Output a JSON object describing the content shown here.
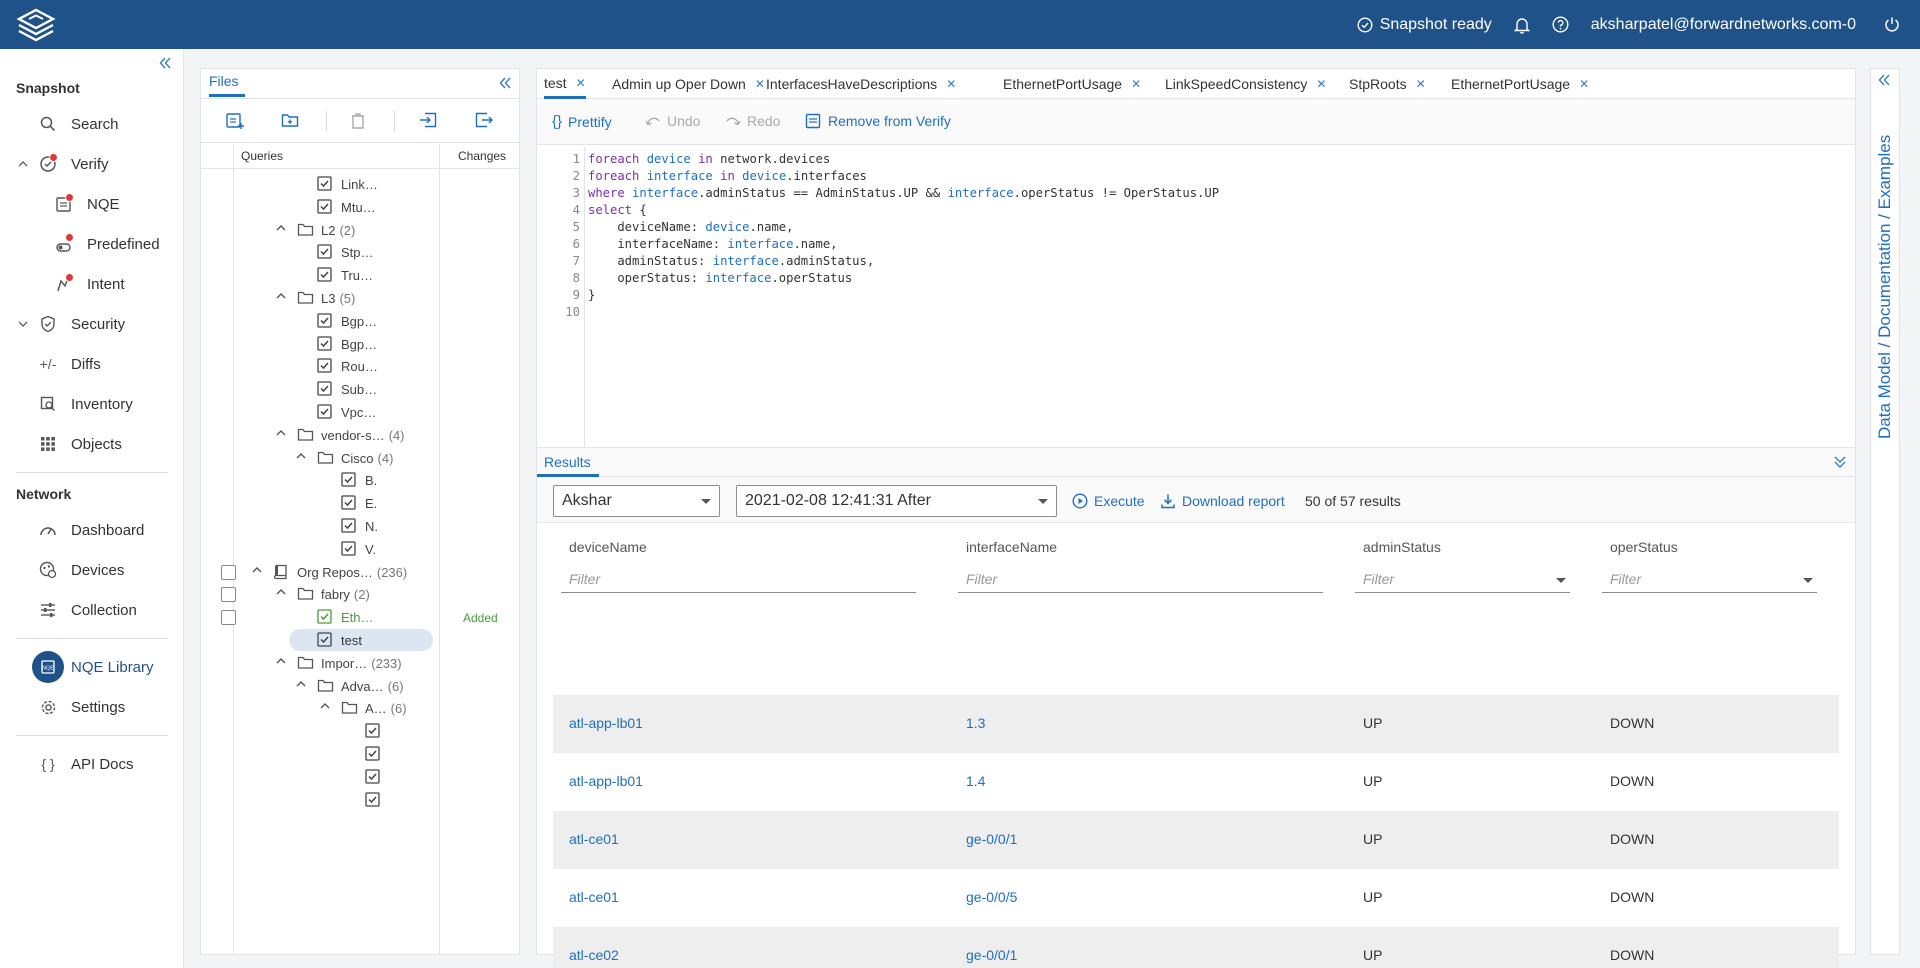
{
  "topbar": {
    "status": "Snapshot ready",
    "user": "aksharpatel@forwardnetworks.com-0"
  },
  "nav": {
    "snapshot_heading": "Snapshot",
    "search": "Search",
    "verify": "Verify",
    "nqe": "NQE",
    "predefined": "Predefined",
    "intent": "Intent",
    "security": "Security",
    "diffs": "Diffs",
    "inventory": "Inventory",
    "objects": "Objects",
    "network_heading": "Network",
    "dashboard": "Dashboard",
    "devices": "Devices",
    "collection": "Collection",
    "nqe_library": "NQE Library",
    "settings": "Settings",
    "api_docs": "API Docs"
  },
  "files": {
    "tab": "Files",
    "col_queries": "Queries",
    "col_changes": "Changes",
    "tree": [
      {
        "label": "Link…",
        "count": ""
      },
      {
        "label": "Mtu…",
        "count": ""
      },
      {
        "label": "L2",
        "count": "(2)"
      },
      {
        "label": "Stp…",
        "count": ""
      },
      {
        "label": "Tru…",
        "count": ""
      },
      {
        "label": "L3",
        "count": "(5)"
      },
      {
        "label": "Bgp…",
        "count": ""
      },
      {
        "label": "Bgp…",
        "count": ""
      },
      {
        "label": "Rou…",
        "count": ""
      },
      {
        "label": "Sub…",
        "count": ""
      },
      {
        "label": "Vpc…",
        "count": ""
      },
      {
        "label": "vendor-s…",
        "count": "(4)"
      },
      {
        "label": "Cisco",
        "count": "(4)"
      },
      {
        "label": "B.",
        "count": ""
      },
      {
        "label": "E.",
        "count": ""
      },
      {
        "label": "N.",
        "count": ""
      },
      {
        "label": "V.",
        "count": ""
      },
      {
        "label": "Org Repos…",
        "count": "(236)"
      },
      {
        "label": "fabry",
        "count": "(2)"
      },
      {
        "label": "Eth…",
        "count": ""
      },
      {
        "label": "test",
        "count": ""
      },
      {
        "label": "Impor…",
        "count": "(233)"
      },
      {
        "label": "Adva…",
        "count": "(6)"
      },
      {
        "label": "A…",
        "count": "(6)"
      }
    ],
    "added_label": "Added"
  },
  "editor": {
    "tabs": [
      "test",
      "Admin up Oper Down",
      "InterfacesHaveDescriptions",
      "EthernetPortUsage",
      "LinkSpeedConsistency",
      "StpRoots",
      "EthernetPortUsage"
    ],
    "prettify": "Prettify",
    "undo": "Undo",
    "redo": "Redo",
    "remove": "Remove from Verify",
    "line_numbers": [
      "1",
      "2",
      "3",
      "4",
      "5",
      "6",
      "7",
      "8",
      "9",
      "10"
    ]
  },
  "results": {
    "tab": "Results",
    "user_select": "Akshar",
    "snapshot_select": "2021-02-08 12:41:31 After",
    "execute": "Execute",
    "download": "Download report",
    "count": "50 of 57 results",
    "filter_placeholder": "Filter",
    "columns": [
      "deviceName",
      "interfaceName",
      "adminStatus",
      "operStatus"
    ],
    "rows": [
      [
        "atl-app-lb01",
        "1.3",
        "UP",
        "DOWN"
      ],
      [
        "atl-app-lb01",
        "1.4",
        "UP",
        "DOWN"
      ],
      [
        "atl-ce01",
        "ge-0/0/1",
        "UP",
        "DOWN"
      ],
      [
        "atl-ce01",
        "ge-0/0/5",
        "UP",
        "DOWN"
      ],
      [
        "atl-ce02",
        "ge-0/0/1",
        "UP",
        "DOWN"
      ]
    ]
  },
  "rightrail": {
    "label": "Data Model / Documentation / Examples"
  },
  "colors": {
    "brand": "#1f5288",
    "accent": "#1f6fbf",
    "added": "#4a9c3a",
    "badge": "#d93a3a"
  }
}
